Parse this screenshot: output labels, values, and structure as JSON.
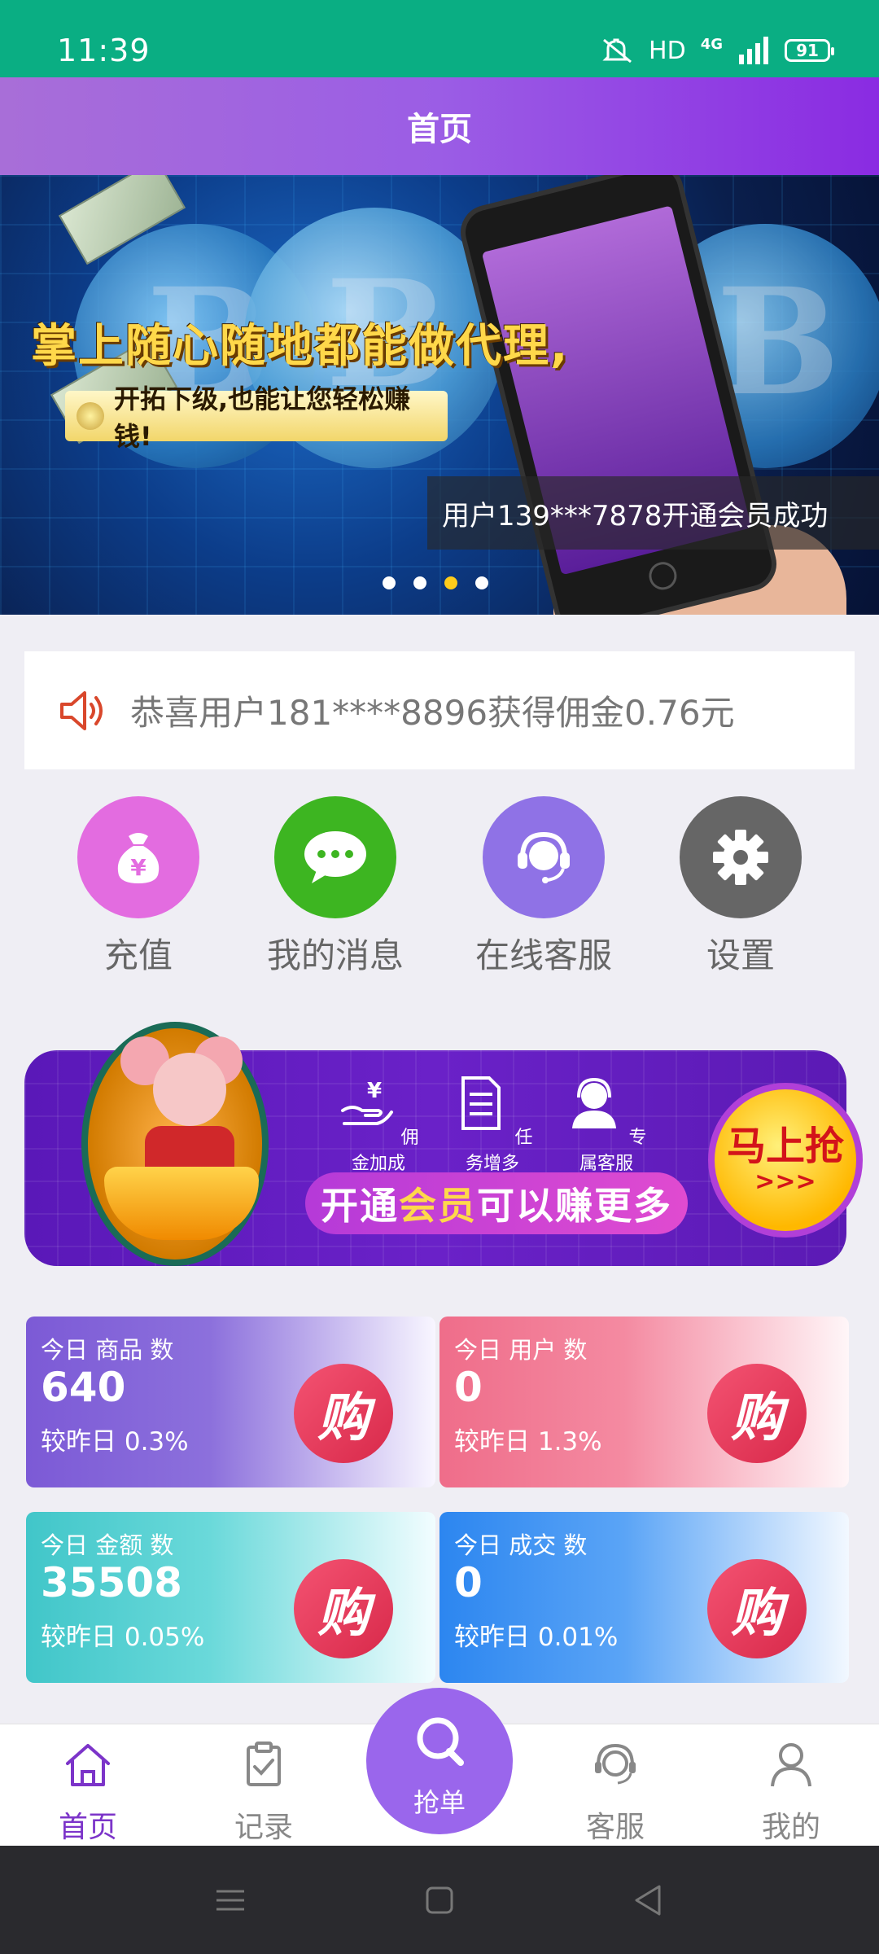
{
  "status_bar": {
    "time": "11:39",
    "hd": "HD",
    "network": "4G",
    "battery": "91"
  },
  "header": {
    "title": "首页"
  },
  "hero": {
    "headline": "掌上随心随地都能做代理,",
    "subline": "开拓下级,也能让您轻松赚钱!",
    "caption": "用户139***7878开通会员成功",
    "dots": 4,
    "active_dot": 3
  },
  "notice": {
    "text": "恭喜用户181****8896获得佣金0.76元"
  },
  "quick_actions": [
    {
      "label": "充值",
      "icon": "money-bag-icon",
      "color": "#e36ce0"
    },
    {
      "label": "我的消息",
      "icon": "chat-bubble-icon",
      "color": "#3db521"
    },
    {
      "label": "在线客服",
      "icon": "headset-icon",
      "color": "#8f72e6"
    },
    {
      "label": "设置",
      "icon": "gear-icon",
      "color": "#666666"
    }
  ],
  "member_banner": {
    "features": [
      "佣金加成",
      "任务增多",
      "专属客服"
    ],
    "pill_pre": "开通",
    "pill_hl": "会员",
    "pill_post": "可以赚更多",
    "grab_label": "马上抢",
    "grab_arrows": ">>>"
  },
  "stats": [
    {
      "label": "今日 商品 数",
      "value": "640",
      "compare": "较昨日 0.3%",
      "badge": "购"
    },
    {
      "label": "今日 用户 数",
      "value": "0",
      "compare": "较昨日 1.3%",
      "badge": "购"
    },
    {
      "label": "今日 金额 数",
      "value": "35508",
      "compare": "较昨日 0.05%",
      "badge": "购"
    },
    {
      "label": "今日 成交 数",
      "value": "0",
      "compare": "较昨日 0.01%",
      "badge": "购"
    }
  ],
  "bottom_nav": {
    "home": "首页",
    "records": "记录",
    "grab": "抢单",
    "service": "客服",
    "mine": "我的"
  },
  "colors": {
    "status_bar": "#0aae83",
    "accent": "#7c34c9",
    "header_gradient": [
      "#a86ed8",
      "#8a2be2"
    ]
  }
}
